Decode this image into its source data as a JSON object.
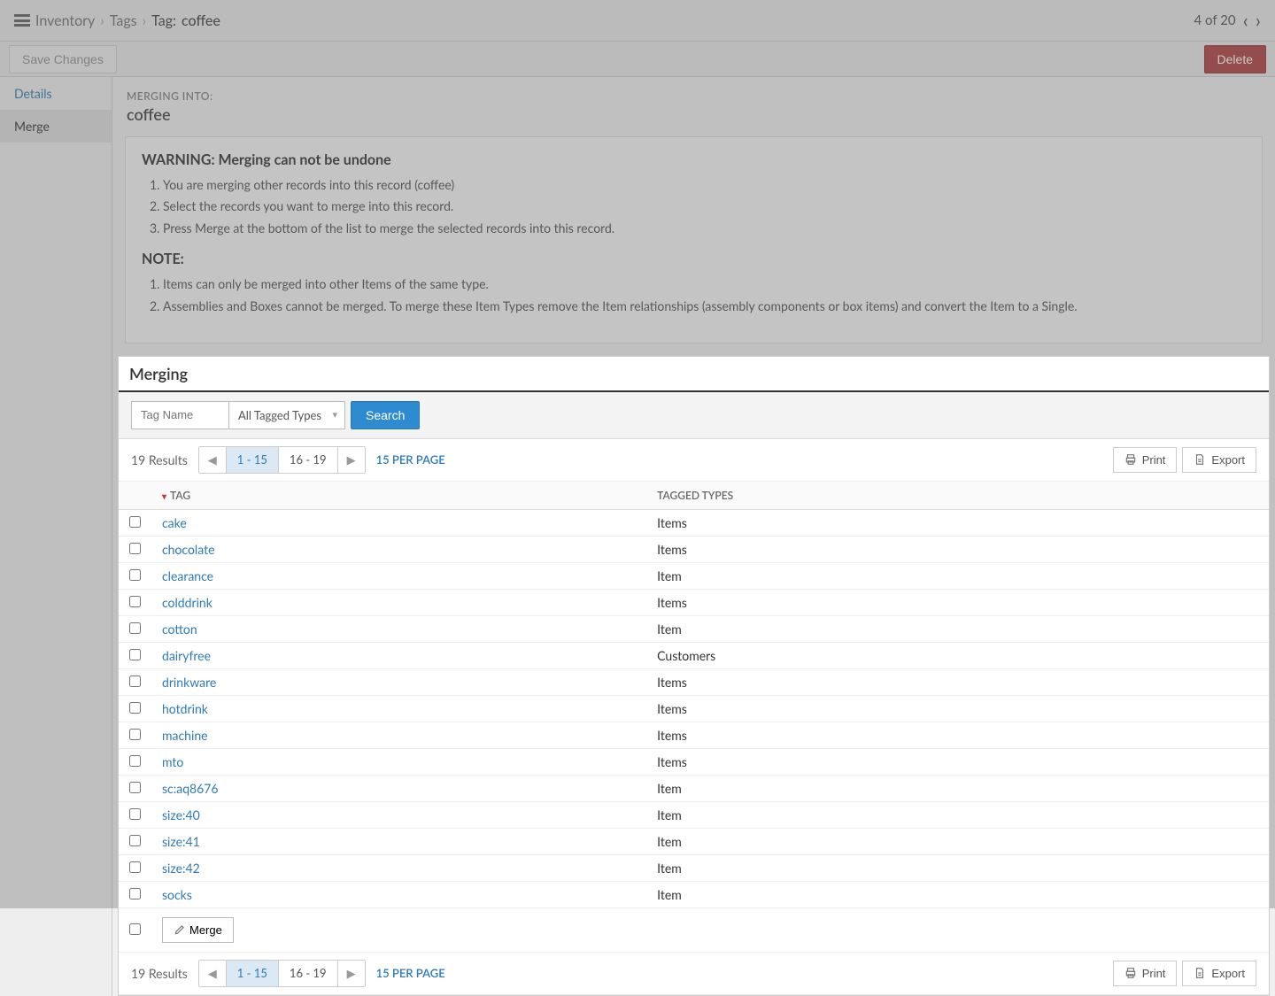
{
  "breadcrumb": {
    "root": "Inventory",
    "mid": "Tags",
    "leaf_label": "Tag:",
    "leaf_value": "coffee"
  },
  "pager": {
    "text": "4 of 20"
  },
  "actions": {
    "save": "Save Changes",
    "delete": "Delete"
  },
  "sidebar": {
    "tabs": [
      "Details",
      "Merge"
    ]
  },
  "merge_header": {
    "label": "MERGING INTO:",
    "title": "coffee"
  },
  "warning": {
    "heading": "WARNING: Merging can not be undone",
    "steps": [
      "You are merging other records into this record (coffee)",
      "Select the records you want to merge into this record.",
      "Press Merge at the bottom of the list to merge the selected records into this record."
    ],
    "note_heading": "NOTE:",
    "notes": [
      "Items can only be merged into other Items of the same type.",
      "Assemblies and Boxes cannot be merged. To merge these Item Types remove the Item relationships (assembly components or box items) and convert the Item to a Single."
    ]
  },
  "section": {
    "title": "Merging",
    "search": {
      "placeholder": "Tag Name",
      "type_filter": "All Tagged Types",
      "button": "Search"
    },
    "results": {
      "count": "19 Results",
      "pages": [
        "1 - 15",
        "16 - 19"
      ],
      "per_page": "15 PER PAGE",
      "print": "Print",
      "export": "Export"
    },
    "columns": {
      "tag": "TAG",
      "types": "TAGGED TYPES"
    },
    "rows": [
      {
        "tag": "cake",
        "types": "Items"
      },
      {
        "tag": "chocolate",
        "types": "Items"
      },
      {
        "tag": "clearance",
        "types": "Item"
      },
      {
        "tag": "colddrink",
        "types": "Items"
      },
      {
        "tag": "cotton",
        "types": "Item"
      },
      {
        "tag": "dairyfree",
        "types": "Customers"
      },
      {
        "tag": "drinkware",
        "types": "Items"
      },
      {
        "tag": "hotdrink",
        "types": "Items"
      },
      {
        "tag": "machine",
        "types": "Items"
      },
      {
        "tag": "mto",
        "types": "Items"
      },
      {
        "tag": "sc:aq8676",
        "types": "Item"
      },
      {
        "tag": "size:40",
        "types": "Item"
      },
      {
        "tag": "size:41",
        "types": "Item"
      },
      {
        "tag": "size:42",
        "types": "Item"
      },
      {
        "tag": "socks",
        "types": "Item"
      }
    ],
    "merge_button": "Merge"
  }
}
